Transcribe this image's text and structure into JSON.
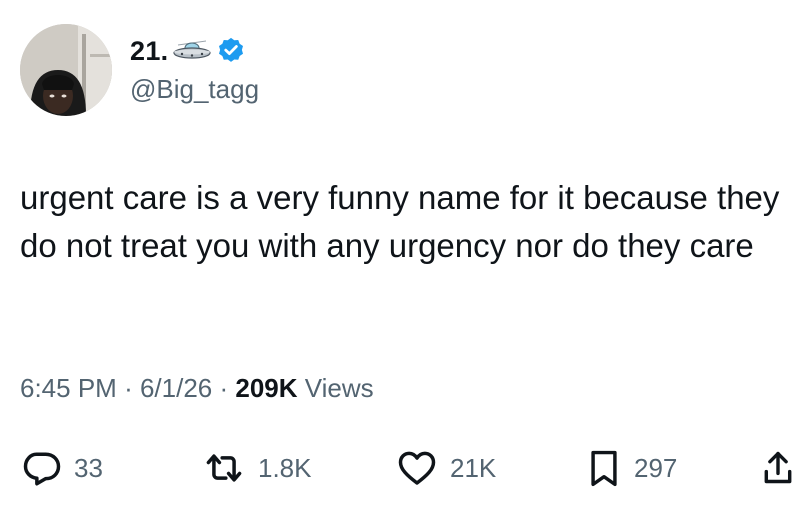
{
  "user": {
    "display_name": "21.",
    "handle": "@Big_tagg",
    "verified": true,
    "name_emoji": "ufo-icon",
    "avatar": "avatar"
  },
  "tweet": {
    "text": "urgent care is a very funny name for it because they do not treat you with any urgency nor do they care"
  },
  "meta": {
    "time": "6:45 PM",
    "date": "6/1/26",
    "separator": "·",
    "views_count": "209K",
    "views_label": "Views"
  },
  "actions": {
    "reply": {
      "icon": "reply-icon",
      "count": "33"
    },
    "retweet": {
      "icon": "retweet-icon",
      "count": "1.8K"
    },
    "like": {
      "icon": "heart-icon",
      "count": "21K"
    },
    "bookmark": {
      "icon": "bookmark-icon",
      "count": "297"
    },
    "share": {
      "icon": "share-icon"
    }
  },
  "colors": {
    "text_primary": "#0f1419",
    "text_secondary": "#536471",
    "verified_blue": "#1d9bf0",
    "background": "#ffffff"
  }
}
